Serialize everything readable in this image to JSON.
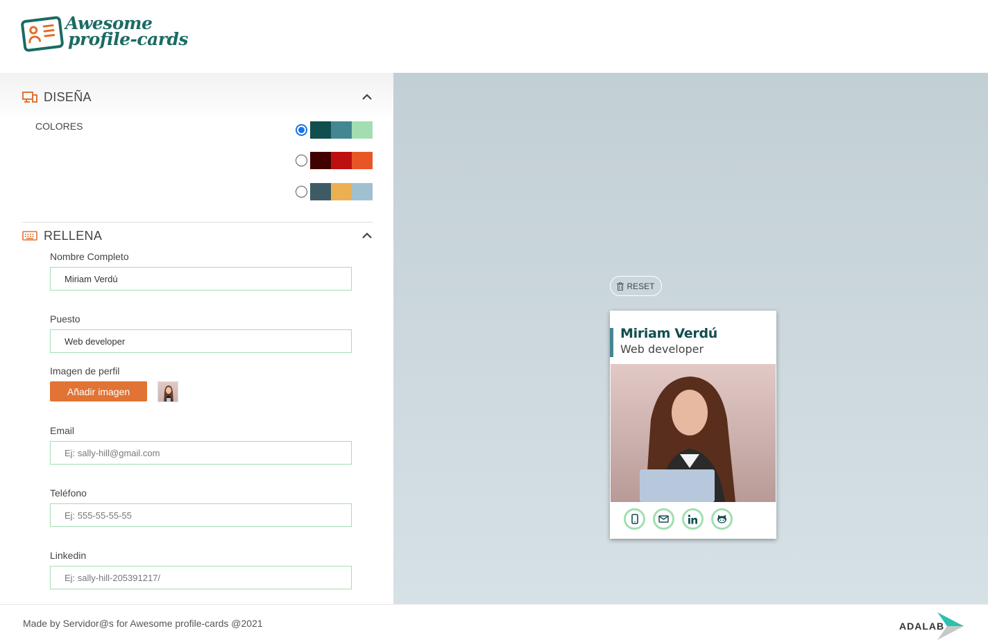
{
  "header": {
    "logo_line1": "Awesome",
    "logo_line2": "profile-cards"
  },
  "design": {
    "title": "DISEÑA",
    "colores_label": "COLORES",
    "palettes": [
      {
        "selected": true,
        "colors": [
          "#114e4e",
          "#438792",
          "#a2deb2"
        ]
      },
      {
        "selected": false,
        "colors": [
          "#420101",
          "#bd1010",
          "#e95626"
        ]
      },
      {
        "selected": false,
        "colors": [
          "#3e5b65",
          "#eab052",
          "#a0c0cf"
        ]
      }
    ]
  },
  "fill": {
    "title": "RELLENA",
    "name_label": "Nombre Completo",
    "name_value": "Miriam Verdú",
    "job_label": "Puesto",
    "job_value": "Web developer",
    "image_label": "Imagen de perfil",
    "add_image_button": "Añadir imagen",
    "email_label": "Email",
    "email_placeholder": "Ej: sally-hill@gmail.com",
    "phone_label": "Teléfono",
    "phone_placeholder": "Ej: 555-55-55-55",
    "linkedin_label": "Linkedin",
    "linkedin_placeholder": "Ej: sally-hill-205391217/"
  },
  "preview": {
    "reset_label": "RESET",
    "card_name": "Miriam Verdú",
    "card_job": "Web developer",
    "socials": [
      "mobile-icon",
      "envelope-icon",
      "linkedin-icon",
      "github-icon"
    ]
  },
  "footer": {
    "text": "Made by Servidor@s for Awesome profile-cards @2021",
    "brand": "ADALAB"
  },
  "colors": {
    "accent_orange": "#e17334",
    "brand_green": "#1b6b63",
    "input_border": "#a2deb2"
  }
}
